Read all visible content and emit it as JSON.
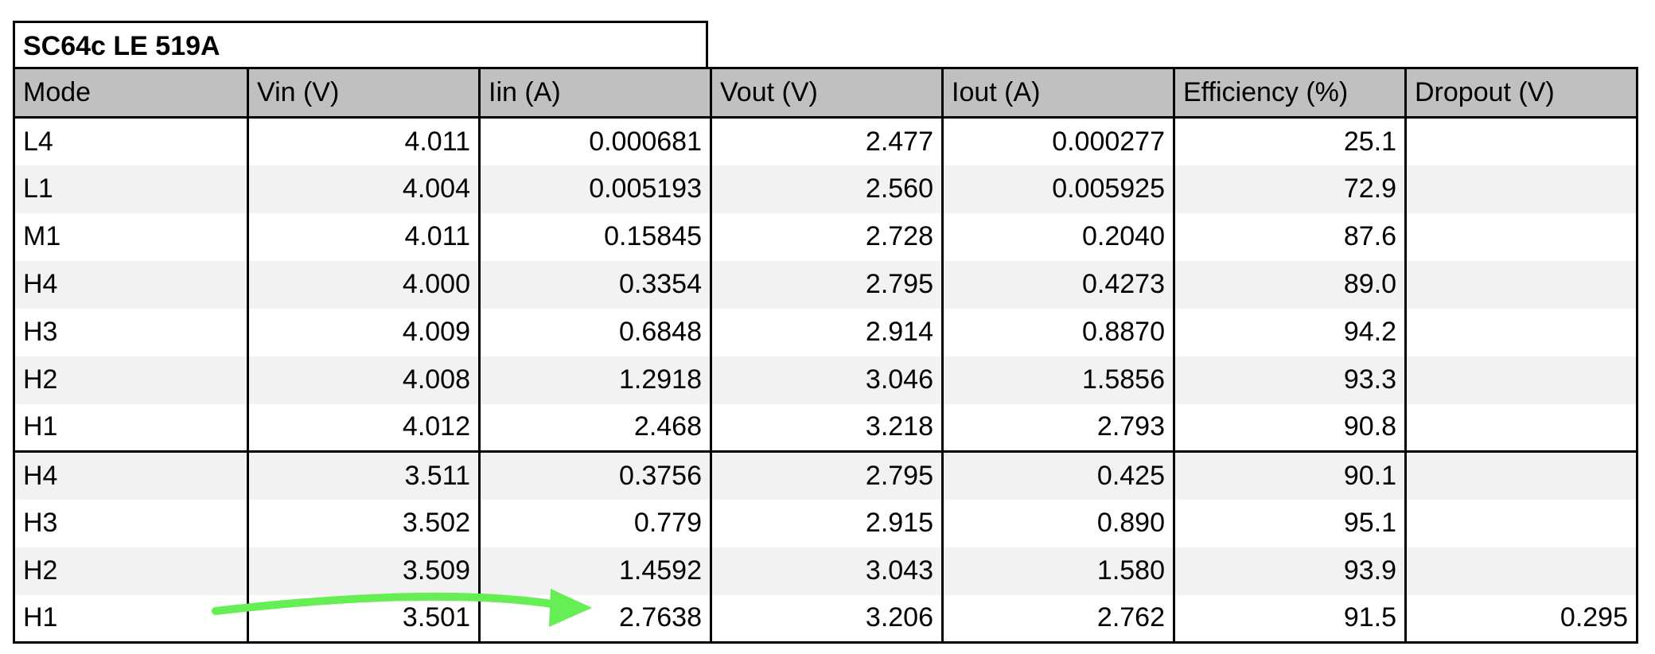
{
  "table": {
    "title": "SC64c LE 519A",
    "headers": [
      "Mode",
      "Vin (V)",
      "Iin (A)",
      "Vout (V)",
      "Iout (A)",
      "Efficiency (%)",
      "Dropout (V)"
    ],
    "rows": [
      [
        "L4",
        "4.011",
        "0.000681",
        "2.477",
        "0.000277",
        "25.1",
        ""
      ],
      [
        "L1",
        "4.004",
        "0.005193",
        "2.560",
        "0.005925",
        "72.9",
        ""
      ],
      [
        "M1",
        "4.011",
        "0.15845",
        "2.728",
        "0.2040",
        "87.6",
        ""
      ],
      [
        "H4",
        "4.000",
        "0.3354",
        "2.795",
        "0.4273",
        "89.0",
        ""
      ],
      [
        "H3",
        "4.009",
        "0.6848",
        "2.914",
        "0.8870",
        "94.2",
        ""
      ],
      [
        "H2",
        "4.008",
        "1.2918",
        "3.046",
        "1.5856",
        "93.3",
        ""
      ],
      [
        "H1",
        "4.012",
        "2.468",
        "3.218",
        "2.793",
        "90.8",
        ""
      ],
      [
        "H4",
        "3.511",
        "0.3756",
        "2.795",
        "0.425",
        "90.1",
        ""
      ],
      [
        "H3",
        "3.502",
        "0.779",
        "2.915",
        "0.890",
        "95.1",
        ""
      ],
      [
        "H2",
        "3.509",
        "1.4592",
        "3.043",
        "1.580",
        "93.9",
        ""
      ],
      [
        "H1",
        "3.501",
        "2.7638",
        "3.206",
        "2.762",
        "91.5",
        "0.295"
      ]
    ]
  },
  "annotation": {
    "arrow_color": "#66ee55",
    "icon": "arrow-right-icon"
  }
}
